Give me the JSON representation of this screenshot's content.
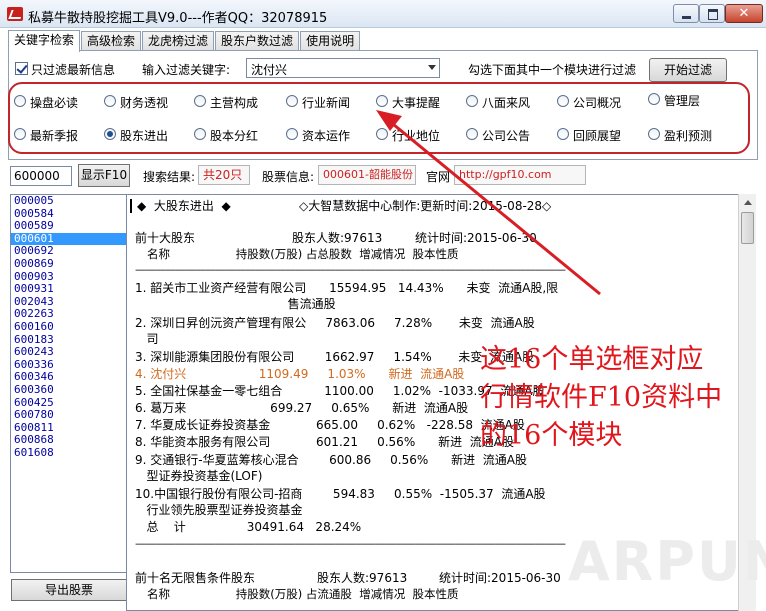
{
  "window": {
    "title": "私募牛散持股挖掘工具V9.0---作者QQ：32078915",
    "close_label": "✕"
  },
  "tabs": [
    "关键字检索",
    "高级检索",
    "龙虎榜过滤",
    "股东户数过滤",
    "使用说明"
  ],
  "filter": {
    "only_latest_label": "只过滤最新信息",
    "keyword_label": "输入过滤关键字:",
    "keyword_value": "沈付兴",
    "hint_label": "勾选下面其中一个模块进行过滤",
    "start_button": "开始过滤"
  },
  "modules": {
    "row1": [
      "操盘必读",
      "财务透视",
      "主营构成",
      "行业新闻",
      "大事提醒",
      "八面来风",
      "公司概况",
      "管理层"
    ],
    "row2": [
      "最新季报",
      "股东进出",
      "股本分红",
      "资本运作",
      "行业地位",
      "公司公告",
      "回顾展望",
      "盈利预测"
    ],
    "selected": "股东进出"
  },
  "search": {
    "code_input": "600000",
    "show_f10_button": "显示F10",
    "result_label": "搜索结果:",
    "result_value": "共20只",
    "stock_info_label": "股票信息:",
    "stock_info_value": "000601-韶能股份",
    "website_label": "官网",
    "website_value": "http://gpf10.com"
  },
  "codes": [
    "000005",
    "000584",
    "000589",
    "000601",
    "000692",
    "000869",
    "000903",
    "000931",
    "002043",
    "002263",
    "600160",
    "600183",
    "600243",
    "600336",
    "600346",
    "600360",
    "600425",
    "600780",
    "600811",
    "600868",
    "601608"
  ],
  "selected_code": "000601",
  "export_button": "导出股票",
  "f10": {
    "title": "◆  大股东进出  ◆",
    "source": "◇大智慧数据中心制作:更新时间:2015-08-28◇",
    "sec1_heading": "前十大股东",
    "sec1_holders": "股东人数:97613",
    "sec1_date": "统计时间:2015-06-30",
    "sec1_cols": "名称                  持股数(万股) 占总股数  增减情况  股本性质",
    "divider": "———————————————————————————————————————————",
    "rows": [
      "1. 韶关市工业资产经营有限公司      15594.95   14.43%      未变  流通A股,限",
      "                                        售流通股",
      "2. 深圳日昇创沅资产管理有限公     7863.06     7.28%       未变  流通A股",
      "   司",
      "3. 深圳能源集团股份有限公司        1662.97     1.54%       未变  流通A股",
      "4. 沈付兴                   1109.49     1.03%      新进  流通A股",
      "5. 全国社保基金一零七组合           1100.00     1.02%  -1033.97  流通A股",
      "6. 葛万来                      699.27     0.65%      新进  流通A股",
      "7. 华夏成长证券投资基金            665.00     0.62%   -228.58  流通A股",
      "8. 华能资本服务有限公司            601.21     0.56%      新进  流通A股",
      "9. 交通银行-华夏蓝筹核心混合        600.86     0.56%      新进  流通A股",
      "   型证券投资基金(LOF)",
      "10.中国银行股份有限公司-招商        594.83     0.55%  -1505.37  流通A股",
      "   行业领先股票型证券投资基金",
      "   总    计                30491.64   28.24%"
    ],
    "sec2_heading": "前十名无限售条件股东",
    "sec2_holders": "股东人数:97613",
    "sec2_date": "统计时间:2015-06-30",
    "sec2_cols": "名称                  持股数(万股) 占流通股  增减情况  股本性质"
  },
  "annotation": "这16个单选框对应行情软件F10资料中的16个模块",
  "watermark": "ARPUN",
  "colors": {
    "annotation_red": "#e0161d",
    "selection_blue": "#3399ff",
    "highlight_orange": "#d2691e"
  }
}
